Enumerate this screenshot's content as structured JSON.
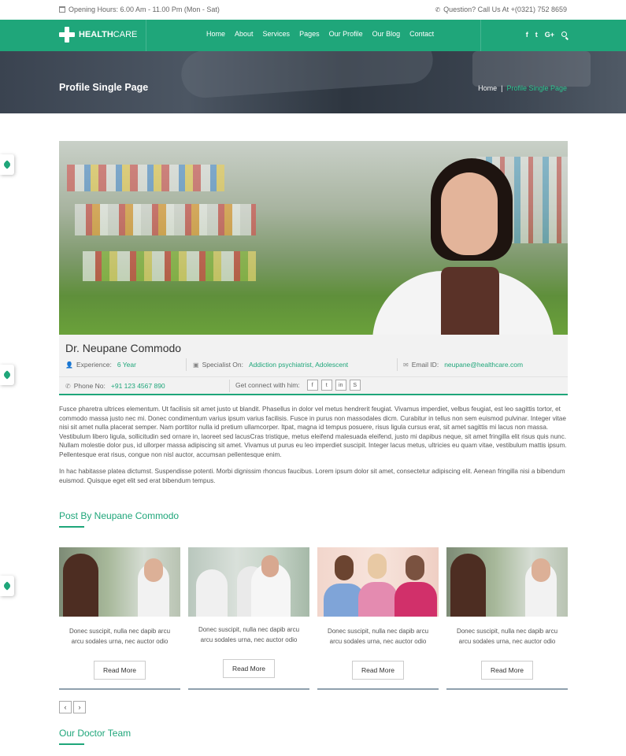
{
  "topbar": {
    "hours_icon": "calendar-icon",
    "hours": "Opening Hours: 6.00 Am - 11.00 Pm (Mon - Sat)",
    "phone_icon": "phone-icon",
    "phone": "Question? Call Us At +(0321) 752 8659"
  },
  "brand": {
    "name_bold": "HEALTH",
    "name_light": "CARE"
  },
  "nav": {
    "items": [
      "Home",
      "About",
      "Services",
      "Pages",
      "Our Profile",
      "Our Blog",
      "Contact"
    ],
    "social": [
      "f",
      "t",
      "G+"
    ]
  },
  "hero": {
    "title": "Profile Single Page",
    "breadcrumb_home": "Home",
    "breadcrumb_sep": "|",
    "breadcrumb_current": "Profile Single Page"
  },
  "profile": {
    "name": "Dr. Neupane Commodo",
    "experience_label": "Experience:",
    "experience_value": "6 Year",
    "specialist_label": "Specialist On:",
    "specialist_value": "Addiction psychiatrist, Adolescent",
    "email_label": "Email ID:",
    "email_value": "neupane@healthcare.com",
    "phone_label": "Phone No:",
    "phone_value": "+91 123 4567 890",
    "connect_label": "Get connect with him:",
    "connect_icons": [
      "f",
      "t",
      "in",
      "S"
    ]
  },
  "about": {
    "p1": "Fusce pharetra ultrices elementum. Ut facilisis sit amet justo ut blandit. Phasellus in dolor vel metus hendrerit feugiat. Vivamus imperdiet, velbus feugiat, est leo sagittis tortor, et commodo massa justo nec mi. Donec condimentum varius ipsum varius facilisis. Fusce in purus non massodales dicm. Curabitur in tellus non sem euismod pulvinar. Integer vitae nisi sit amet nulla placerat semper. Nam porttitor nulla id pretium ullamcorper. Itpat, magna id tempus posuere, risus ligula cursus erat, sit amet sagittis mi lacus non massa. Vestibulum libero ligula, sollicitudin sed ornare in, laoreet sed lacusCras tristique, metus eleifend malesuada eleifend, justo mi dapibus neque, sit amet fringilla elit risus quis nunc. Nullam molestie dolor pus, id ullorper massa adipiscing sit amet. Vivamus ut purus eu leo imperdiet suscipit. Integer lacus metus, ultricies eu quam vitae, vestibulum mattis ipsum. Pellentesque erat risus, congue non nisl auctor, accumsan pellentesque enim.",
    "p2": "In hac habitasse platea dictumst. Suspendisse potenti. Morbi dignissim rhoncus faucibus. Lorem ipsum dolor sit amet, consectetur adipiscing elit. Aenean fringilla nisi a bibendum euismod. Quisque eget elit sed erat bibendum tempus."
  },
  "posts": {
    "title": "Post By Neupane Commodo",
    "items": [
      {
        "text": "Donec suscipit, nulla nec dapib arcu arcu sodales urna, nec auctor odio",
        "button": "Read More"
      },
      {
        "text": "Donec suscipit, nulla nec dapib arcu arcu sodales urna, nec auctor odio",
        "button": "Read More"
      },
      {
        "text": "Donec suscipit, nulla nec dapib arcu arcu sodales urna, nec auctor odio",
        "button": "Read More"
      },
      {
        "text": "Donec suscipit, nulla nec dapib arcu arcu sodales urna, nec auctor odio",
        "button": "Read More"
      }
    ],
    "prev": "‹",
    "next": "›"
  },
  "team": {
    "title": "Our Doctor Team"
  },
  "colors": {
    "accent": "#1fa67a",
    "accent_light": "#2ec48f",
    "hero_dark": "#3a4350"
  }
}
